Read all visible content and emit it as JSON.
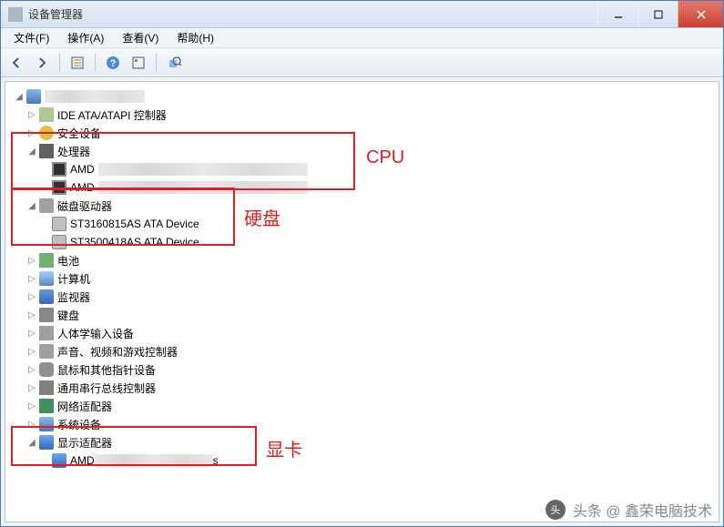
{
  "window": {
    "title": "设备管理器"
  },
  "menu": {
    "file": "文件(F)",
    "action": "操作(A)",
    "view": "查看(V)",
    "help": "帮助(H)"
  },
  "tree": {
    "root": "",
    "ide": "IDE ATA/ATAPI 控制器",
    "security": "安全设备",
    "processor": "处理器",
    "cpu1": "AMD",
    "cpu2": "AMD",
    "disk": "磁盘驱动器",
    "disk1": "ST3160815AS ATA Device",
    "disk2": "ST3500418AS ATA Device",
    "battery": "电池",
    "computer": "计算机",
    "monitor": "监视器",
    "keyboard": "键盘",
    "hid": "人体学输入设备",
    "audio": "声音、视频和游戏控制器",
    "mouse": "鼠标和其他指针设备",
    "usb": "通用串行总线控制器",
    "network": "网络适配器",
    "system": "系统设备",
    "display": "显示适配器",
    "gpu1_prefix": "AMD ",
    "gpu1_suffix": "s"
  },
  "annotations": {
    "cpu": "CPU",
    "disk": "硬盘",
    "gpu": "显卡"
  },
  "watermark": {
    "text": "头条 @ 鑫荣电脑技术"
  }
}
